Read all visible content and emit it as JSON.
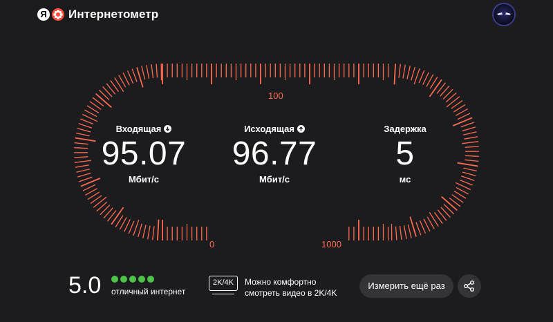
{
  "app": {
    "title": "Интернетометр",
    "logo_letter": "Я"
  },
  "gauge": {
    "labels": {
      "mid": "100",
      "low": "0",
      "high": "1000"
    },
    "accent_color": "#ff6b52"
  },
  "metrics": {
    "download": {
      "title": "Входящая",
      "value": "95.07",
      "unit": "Мбит/с",
      "icon": "arrow-down-icon"
    },
    "upload": {
      "title": "Исходящая",
      "value": "96.77",
      "unit": "Мбит/с",
      "icon": "arrow-up-icon"
    },
    "latency": {
      "title": "Задержка",
      "value": "5",
      "unit": "мс"
    }
  },
  "rating": {
    "value": "5.0",
    "stars": 5,
    "text": "отличный интернет",
    "star_color": "#4ec34a"
  },
  "quality": {
    "badge": "2K/4K",
    "text": "Можно комфортно смотреть видео в 2K/4K"
  },
  "actions": {
    "retest_label": "Измерить ещё раз",
    "share_icon": "share-icon"
  }
}
